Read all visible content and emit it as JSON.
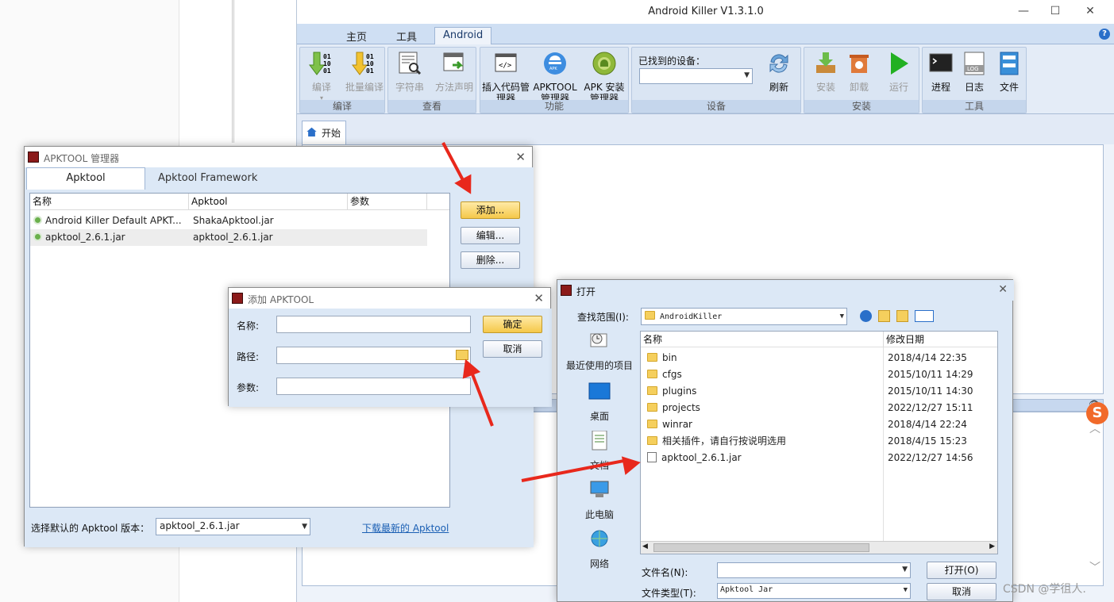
{
  "main_window": {
    "title": "Android Killer V1.3.1.0",
    "menu_tabs": [
      "主页",
      "工具",
      "Android"
    ],
    "ribbon": {
      "compile_group": {
        "label": "编译",
        "buttons": [
          "编译",
          "批量编译"
        ]
      },
      "view_group": {
        "label": "查看",
        "buttons": [
          "字符串",
          "方法声明"
        ]
      },
      "function_group": {
        "label": "功能",
        "buttons": [
          "插入代码管理器",
          "APKTOOL管理器",
          "APK 安装管理器"
        ]
      },
      "device_group": {
        "label": "设备",
        "found_devices_label": "已找到的设备：",
        "refresh": "刷新"
      },
      "install_group": {
        "label": "安装",
        "buttons": [
          "安装",
          "卸载",
          "运行"
        ]
      },
      "tools_group": {
        "label": "工具",
        "buttons": [
          "进程",
          "日志",
          "文件"
        ]
      }
    },
    "doc_tab": "开始"
  },
  "apktool_manager": {
    "title": "APKTOOL 管理器",
    "tabs": [
      "Apktool",
      "Apktool Framework"
    ],
    "columns": [
      "名称",
      "Apktool",
      "参数"
    ],
    "rows": [
      {
        "name": "Android Killer Default APKT...",
        "apktool": "ShakaApktool.jar",
        "params": ""
      },
      {
        "name": "apktool_2.6.1.jar",
        "apktool": "apktool_2.6.1.jar",
        "params": ""
      }
    ],
    "buttons": {
      "add": "添加...",
      "edit": "编辑...",
      "delete": "删除..."
    },
    "default_version_label": "选择默认的 Apktool 版本：",
    "default_version_value": "apktool_2.6.1.jar",
    "download_link": "下载最新的 Apktool"
  },
  "add_apktool": {
    "title": "添加 APKTOOL",
    "name_label": "名称:",
    "path_label": "路径:",
    "params_label": "参数:",
    "ok": "确定",
    "cancel": "取消"
  },
  "open_dialog": {
    "title": "打开",
    "look_in_label": "查找范围(I):",
    "look_in_value": "AndroidKiller",
    "places": [
      "最近使用的项目",
      "桌面",
      "文档",
      "此电脑",
      "网络"
    ],
    "columns": [
      "名称",
      "修改日期"
    ],
    "files": [
      {
        "name": "bin",
        "date": "2018/4/14 22:35",
        "type": "folder"
      },
      {
        "name": "cfgs",
        "date": "2015/10/11 14:29",
        "type": "folder"
      },
      {
        "name": "plugins",
        "date": "2015/10/11 14:30",
        "type": "folder"
      },
      {
        "name": "projects",
        "date": "2022/12/27 15:11",
        "type": "folder"
      },
      {
        "name": "winrar",
        "date": "2018/4/14 22:24",
        "type": "folder"
      },
      {
        "name": "相关插件，请自行按说明选用",
        "date": "2018/4/15 15:23",
        "type": "folder"
      },
      {
        "name": "apktool_2.6.1.jar",
        "date": "2022/12/27 14:56",
        "type": "jar"
      }
    ],
    "filename_label": "文件名(N):",
    "filetype_label": "文件类型(T):",
    "filetype_value": "Apktool Jar",
    "open_button": "打开(O)",
    "cancel_button": "取消"
  },
  "watermark": "CSDN @学徂人.",
  "colors": {
    "arrow": "#e8281c",
    "gold_button": "#f5c84a",
    "link": "#1a5fb4"
  }
}
